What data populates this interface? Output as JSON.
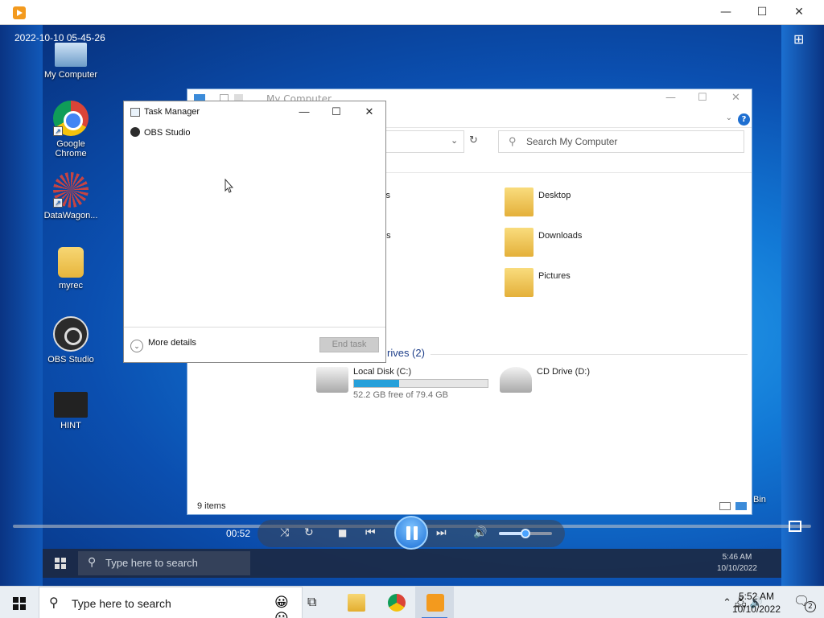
{
  "window": {
    "minimize": "—",
    "maximize": "☐",
    "close": "✕"
  },
  "video": {
    "timestamp": "2022-10-10 05-45-26",
    "elapsed": "00:52",
    "volume_level": 0.5
  },
  "desktop_icons": [
    {
      "label": "My Computer",
      "icon": "my-computer-icon"
    },
    {
      "label": "Google Chrome",
      "icon": "chrome-icon"
    },
    {
      "label": "DataWagon...",
      "icon": "datawagon-icon"
    },
    {
      "label": "myrec",
      "icon": "folder-icon"
    },
    {
      "label": "OBS Studio",
      "icon": "obs-icon"
    },
    {
      "label": "HINT",
      "icon": "hint-video-icon"
    }
  ],
  "explorer": {
    "title": "My Computer",
    "search_placeholder": "Search My Computer",
    "folders": [
      {
        "label": "Desktop"
      },
      {
        "label": "Downloads"
      },
      {
        "label": "Pictures"
      }
    ],
    "left_fragments": [
      "cts",
      "nts"
    ],
    "drives_heading": "rives (2)",
    "drives": [
      {
        "label": "Local Disk (C:)",
        "detail": "52.2 GB free of 79.4 GB",
        "used_fraction": 0.34
      },
      {
        "label": "CD Drive (D:)"
      }
    ],
    "status": "9 items"
  },
  "recycle_label": "Bin",
  "task_manager": {
    "title": "Task Manager",
    "process": "OBS Studio",
    "more_details": "More details",
    "end_task": "End task"
  },
  "recorded_taskbar": {
    "search_placeholder": "Type here to search",
    "time": "5:46 AM",
    "date": "10/10/2022"
  },
  "taskbar": {
    "search_placeholder": "Type here to search",
    "time": "5:52 AM",
    "date": "10/10/2022",
    "notifications": "2",
    "apps": [
      "task-view-icon",
      "file-explorer-icon",
      "chrome-icon",
      "media-player-icon"
    ]
  }
}
